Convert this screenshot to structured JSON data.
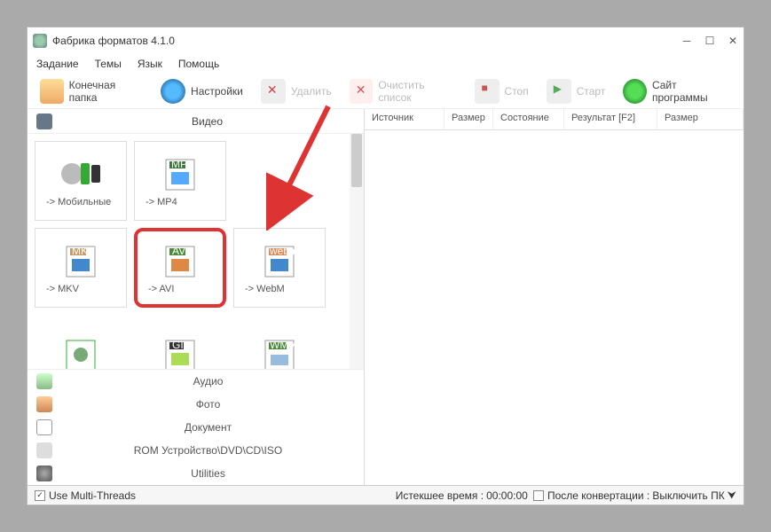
{
  "title": "Фабрика форматов 4.1.0",
  "menu": {
    "task": "Задание",
    "themes": "Темы",
    "lang": "Язык",
    "help": "Помощь"
  },
  "toolbar": {
    "outfolder": "Конечная папка",
    "settings": "Настройки",
    "delete": "Удалить",
    "clear": "Очистить список",
    "stop": "Стоп",
    "start": "Старт",
    "site": "Сайт программы"
  },
  "categories": {
    "video": "Видео",
    "audio": "Аудио",
    "photo": "Фото",
    "document": "Документ",
    "rom": "ROM Устройство\\DVD\\CD\\ISO",
    "utilities": "Utilities"
  },
  "tiles": {
    "mobile": "-> Мобильные",
    "mp4": "-> MP4",
    "mkv": "-> MKV",
    "avi": "-> AVI",
    "webm": "-> WebM",
    "gif": "GIF",
    "wmv": "WMV"
  },
  "columns": {
    "source": "Источник",
    "size": "Размер",
    "state": "Состояние",
    "result": "Результат [F2]",
    "size2": "Размер"
  },
  "status": {
    "multithreads": "Use Multi-Threads",
    "elapsed_label": "Истекшее время :",
    "elapsed_value": "00:00:00",
    "after_label": "После конвертации :",
    "after_value": "Выключить ПК"
  }
}
